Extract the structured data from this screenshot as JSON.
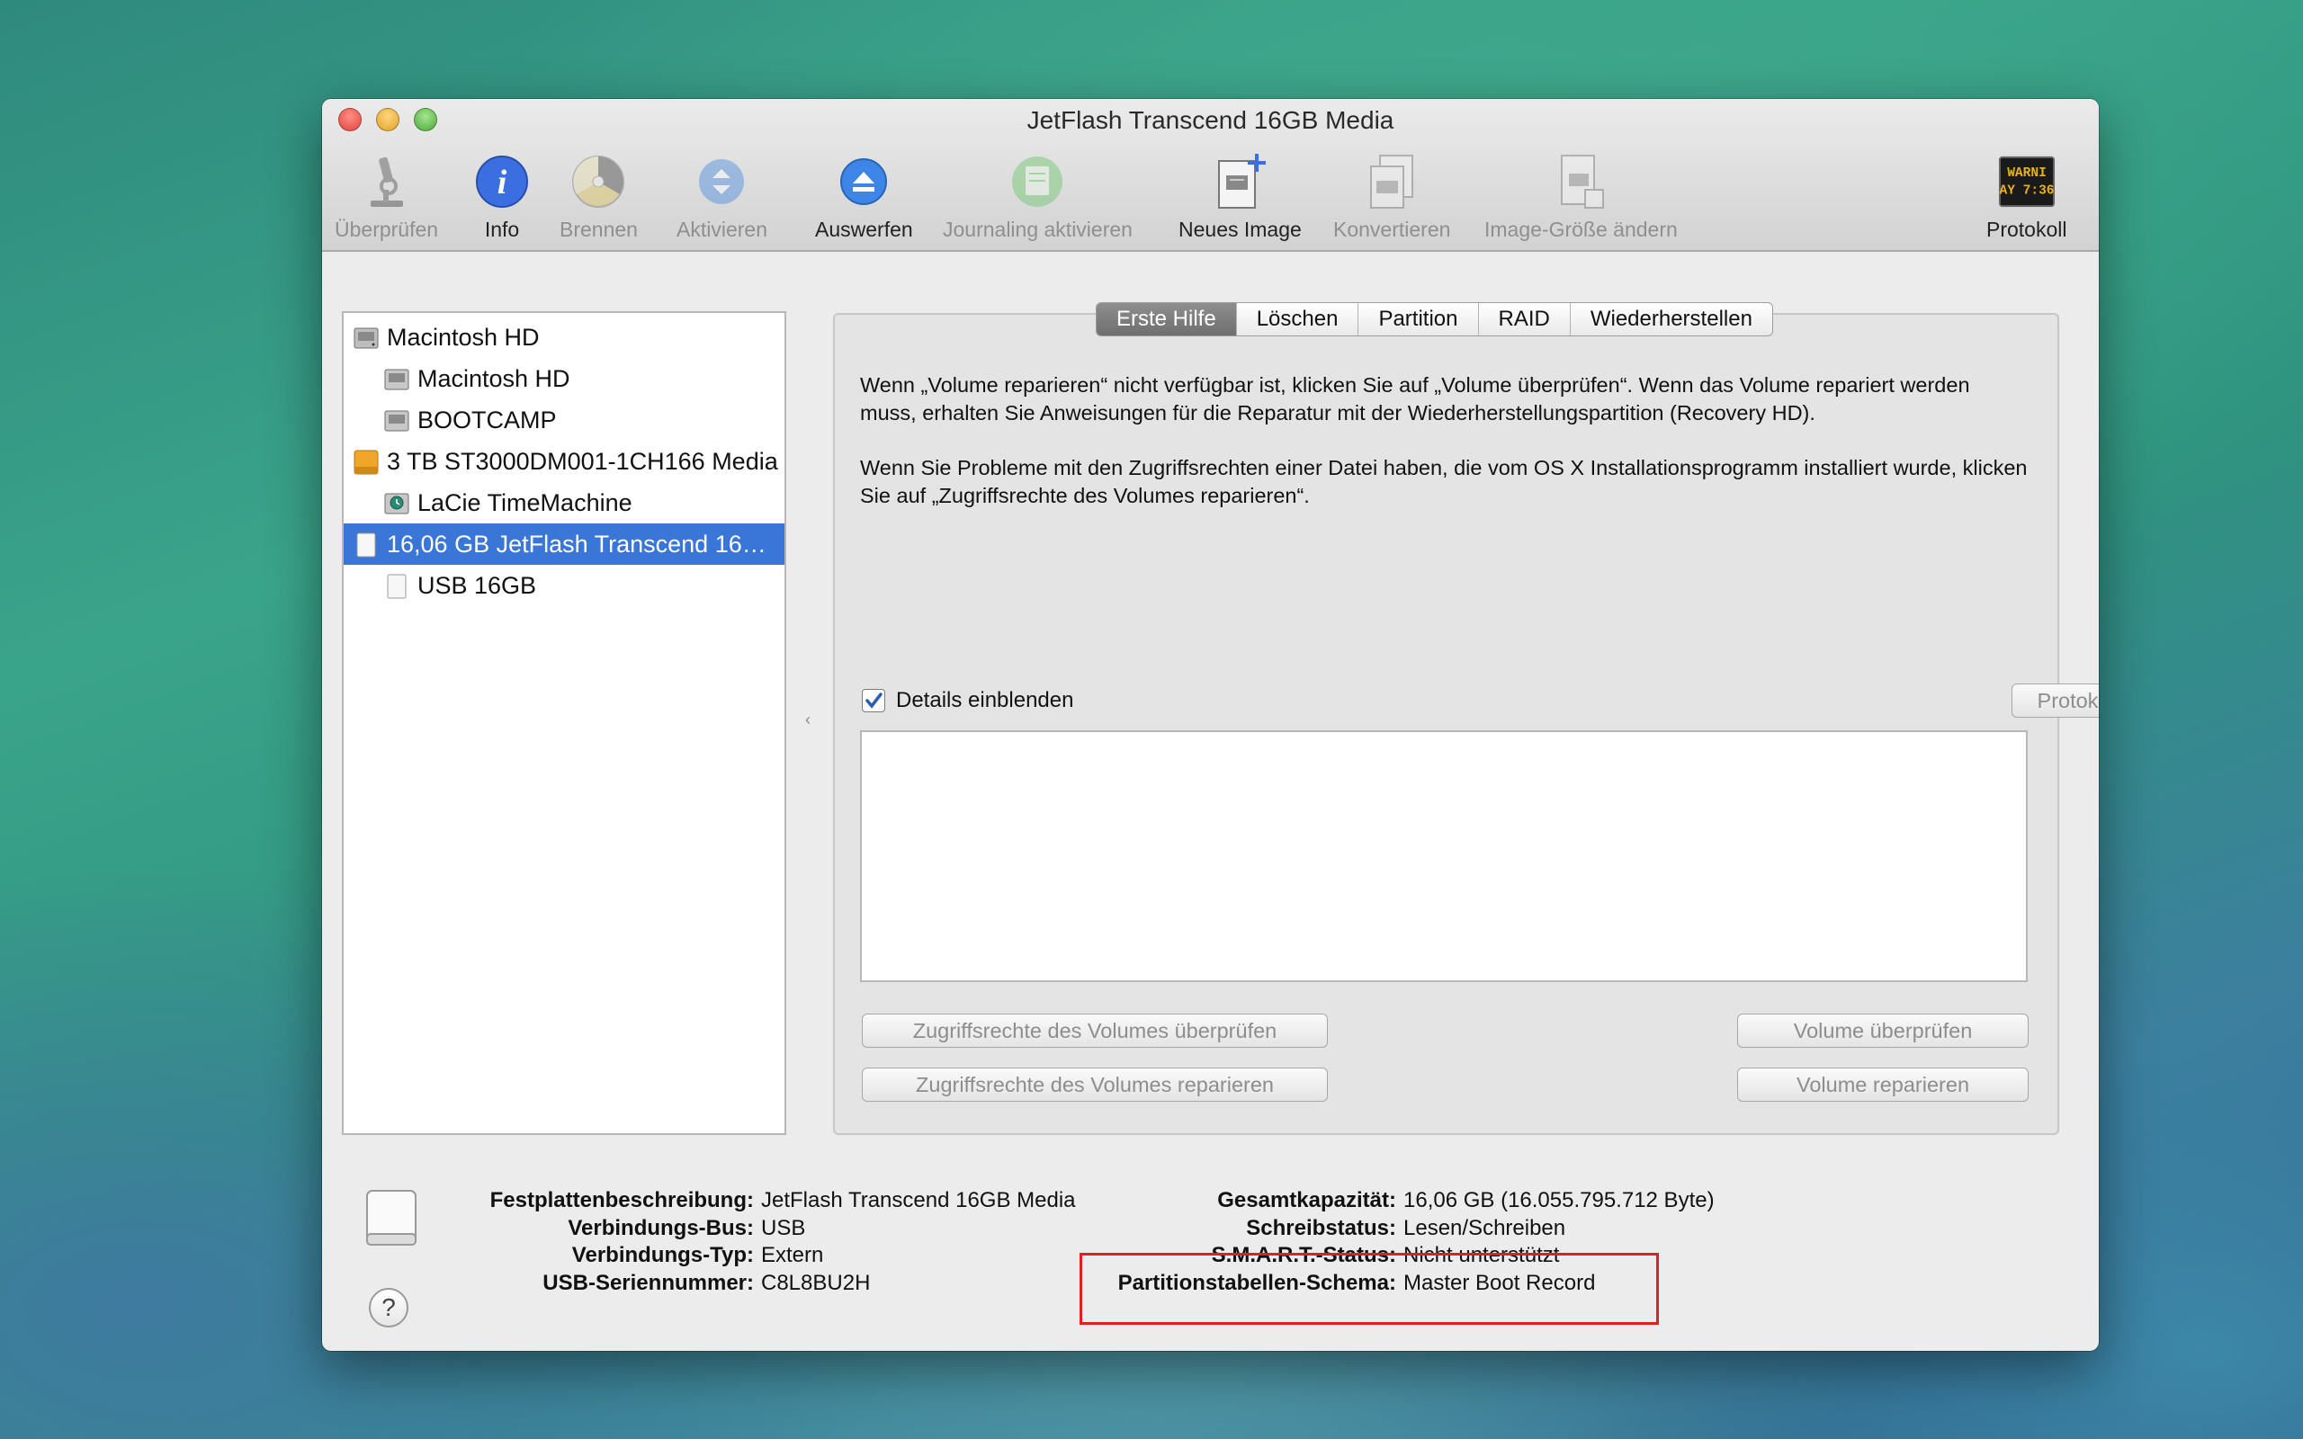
{
  "window": {
    "title": "JetFlash Transcend 16GB Media"
  },
  "toolbar": [
    {
      "label": "Überprüfen",
      "icon": "microscope-icon",
      "enabled": false
    },
    {
      "label": "Info",
      "icon": "info-icon",
      "enabled": true
    },
    {
      "label": "Brennen",
      "icon": "burn-icon",
      "enabled": false
    },
    {
      "label": "Aktivieren",
      "icon": "mount-icon",
      "enabled": false
    },
    {
      "label": "Auswerfen",
      "icon": "eject-icon",
      "enabled": true
    },
    {
      "label": "Journaling aktivieren",
      "icon": "journaling-icon",
      "enabled": false
    },
    {
      "label": "Neues Image",
      "icon": "new-image-icon",
      "enabled": true
    },
    {
      "label": "Konvertieren",
      "icon": "convert-icon",
      "enabled": false
    },
    {
      "label": "Image-Größe ändern",
      "icon": "resize-image-icon",
      "enabled": false
    },
    {
      "label": "Protokoll",
      "icon": "log-icon",
      "enabled": true
    }
  ],
  "log_icon_text": "WARNI\nAY 7:36",
  "sidebar": {
    "items": [
      {
        "label": "Macintosh HD",
        "level": 0,
        "icon": "internal-disk-icon"
      },
      {
        "label": "Macintosh HD",
        "level": 1,
        "icon": "volume-icon"
      },
      {
        "label": "BOOTCAMP",
        "level": 1,
        "icon": "volume-icon"
      },
      {
        "label": "3 TB ST3000DM001-1CH166 Media",
        "level": 0,
        "icon": "external-disk-icon"
      },
      {
        "label": "LaCie TimeMachine",
        "level": 1,
        "icon": "timemachine-volume-icon"
      },
      {
        "label": "16,06 GB JetFlash Transcend 16…",
        "level": 0,
        "icon": "usb-disk-icon",
        "selected": true
      },
      {
        "label": "USB 16GB",
        "level": 1,
        "icon": "usb-volume-icon"
      }
    ]
  },
  "tabs": [
    {
      "label": "Erste Hilfe",
      "active": true
    },
    {
      "label": "Löschen"
    },
    {
      "label": "Partition"
    },
    {
      "label": "RAID"
    },
    {
      "label": "Wiederherstellen"
    }
  ],
  "first_aid": {
    "paragraph1": "Wenn „Volume reparieren“ nicht verfügbar ist, klicken Sie auf „Volume überprüfen“. Wenn das Volume repariert werden muss, erhalten Sie Anweisungen für die Reparatur mit der Wiederherstellungspartition (Recovery HD).",
    "paragraph2": "Wenn Sie Probleme mit den Zugriffsrechten einer Datei haben, die vom OS X Installationsprogramm installiert wurde, klicken Sie auf „Zugriffsrechte des Volumes reparieren“.",
    "details_label": "Details einblenden",
    "details_checked": true,
    "clear_log_button": "Protokoll löschen",
    "verify_permissions_button": "Zugriffsrechte des Volumes überprüfen",
    "repair_permissions_button": "Zugriffsrechte des Volumes reparieren",
    "verify_volume_button": "Volume überprüfen",
    "repair_volume_button": "Volume reparieren"
  },
  "disk_info": {
    "left": [
      {
        "key": "Festplattenbeschreibung:",
        "value": "JetFlash Transcend 16GB Media"
      },
      {
        "key": "Verbindungs-Bus:",
        "value": "USB"
      },
      {
        "key": "Verbindungs-Typ:",
        "value": "Extern"
      },
      {
        "key": "USB-Seriennummer:",
        "value": "C8L8BU2H"
      }
    ],
    "right": [
      {
        "key": "Gesamtkapazität:",
        "value": "16,06 GB (16.055.795.712 Byte)"
      },
      {
        "key": "Schreibstatus:",
        "value": "Lesen/Schreiben"
      },
      {
        "key": "S.M.A.R.T.-Status:",
        "value": "Nicht unterstützt"
      },
      {
        "key": "Partitionstabellen-Schema:",
        "value": "Master Boot Record"
      }
    ]
  },
  "help_button": "?",
  "colors": {
    "selection": "#3a75d8",
    "highlight_box": "#e0201c"
  }
}
